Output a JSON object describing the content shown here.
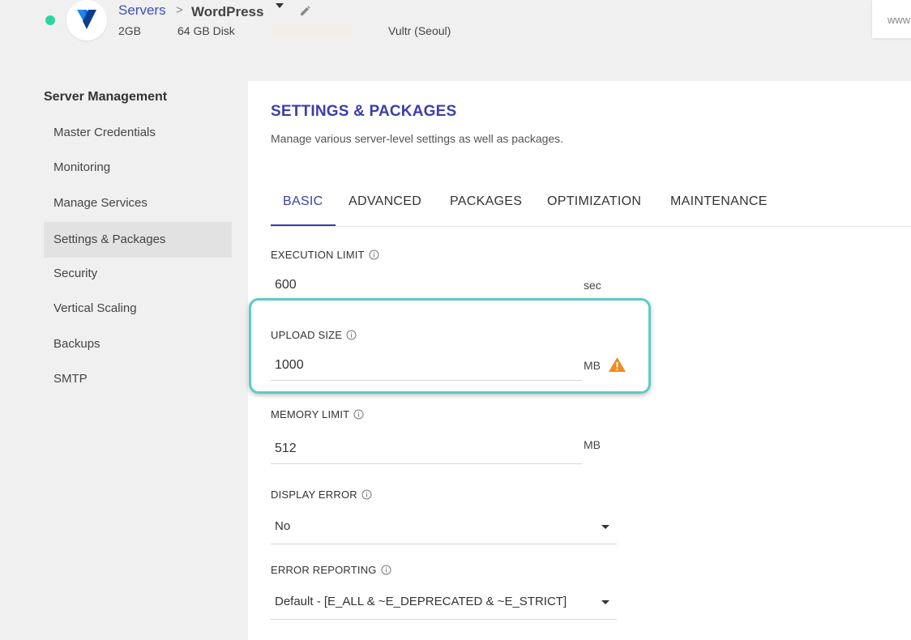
{
  "header": {
    "breadcrumb_servers": "Servers",
    "breadcrumb_separator": ">",
    "app_name": "WordPress",
    "ram": "2GB",
    "disk": "64 GB Disk",
    "location": "Vultr (Seoul)",
    "url_preview": "www",
    "status_color": "#2ed3a0",
    "logo_icon": "vultr-logo-icon"
  },
  "sidebar": {
    "title": "Server Management",
    "items": [
      {
        "label": "Master Credentials"
      },
      {
        "label": "Monitoring"
      },
      {
        "label": "Manage Services"
      },
      {
        "label": "Settings & Packages",
        "active": true
      },
      {
        "label": "Security"
      },
      {
        "label": "Vertical Scaling"
      },
      {
        "label": "Backups"
      },
      {
        "label": "SMTP"
      }
    ]
  },
  "main": {
    "title": "SETTINGS & PACKAGES",
    "subtitle": "Manage various server-level settings as well as packages.",
    "tabs": [
      {
        "label": "BASIC",
        "active": true
      },
      {
        "label": "ADVANCED"
      },
      {
        "label": "PACKAGES"
      },
      {
        "label": "OPTIMIZATION"
      },
      {
        "label": "MAINTENANCE"
      }
    ],
    "fields": {
      "execution_limit": {
        "label": "EXECUTION LIMIT",
        "value": "600",
        "unit": "sec"
      },
      "upload_size": {
        "label": "UPLOAD SIZE",
        "value": "1000",
        "unit": "MB",
        "warning_icon": "warning-triangle-icon"
      },
      "memory_limit": {
        "label": "MEMORY LIMIT",
        "value": "512",
        "unit": "MB"
      },
      "display_error": {
        "label": "DISPLAY ERROR",
        "value": "No"
      },
      "error_reporting": {
        "label": "ERROR REPORTING",
        "value": "Default - [E_ALL & ~E_DEPRECATED & ~E_STRICT]"
      }
    }
  },
  "colors": {
    "accent": "#3a3fa8",
    "link": "#3f51b5",
    "highlight": "#5ccbc5",
    "warning": "#f28c1b"
  }
}
